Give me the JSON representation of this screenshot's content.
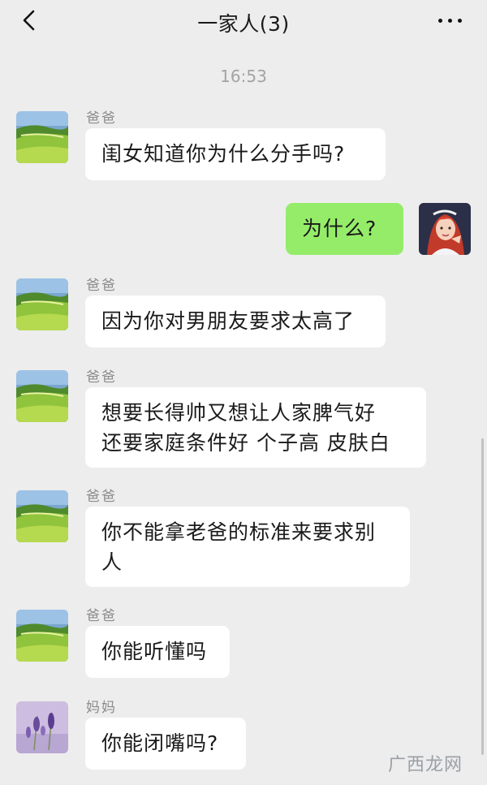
{
  "header": {
    "title": "一家人(3)"
  },
  "timestamp": "16:53",
  "messages": [
    {
      "sender": "爸爸",
      "text": "闺女知道你为什么分手吗?"
    },
    {
      "text": "为什么?"
    },
    {
      "sender": "爸爸",
      "text": "因为你对男朋友要求太高了"
    },
    {
      "sender": "爸爸",
      "line1": "想要长得帅又想让人家脾气好",
      "line2": "还要家庭条件好 个子高 皮肤白"
    },
    {
      "sender": "爸爸",
      "line1": "你不能拿老爸的标准来要求别",
      "line2": "人"
    },
    {
      "sender": "爸爸",
      "text": "你能听懂吗"
    },
    {
      "sender": "妈妈",
      "text": "你能闭嘴吗?"
    }
  ],
  "watermark": "广西龙网",
  "colors": {
    "background": "#ededed",
    "my_bubble": "#95ec69",
    "other_bubble": "#ffffff",
    "sender_text": "#8c8c8c"
  },
  "icons": {
    "back": "back-arrow-icon",
    "more": "more-dots-icon"
  }
}
